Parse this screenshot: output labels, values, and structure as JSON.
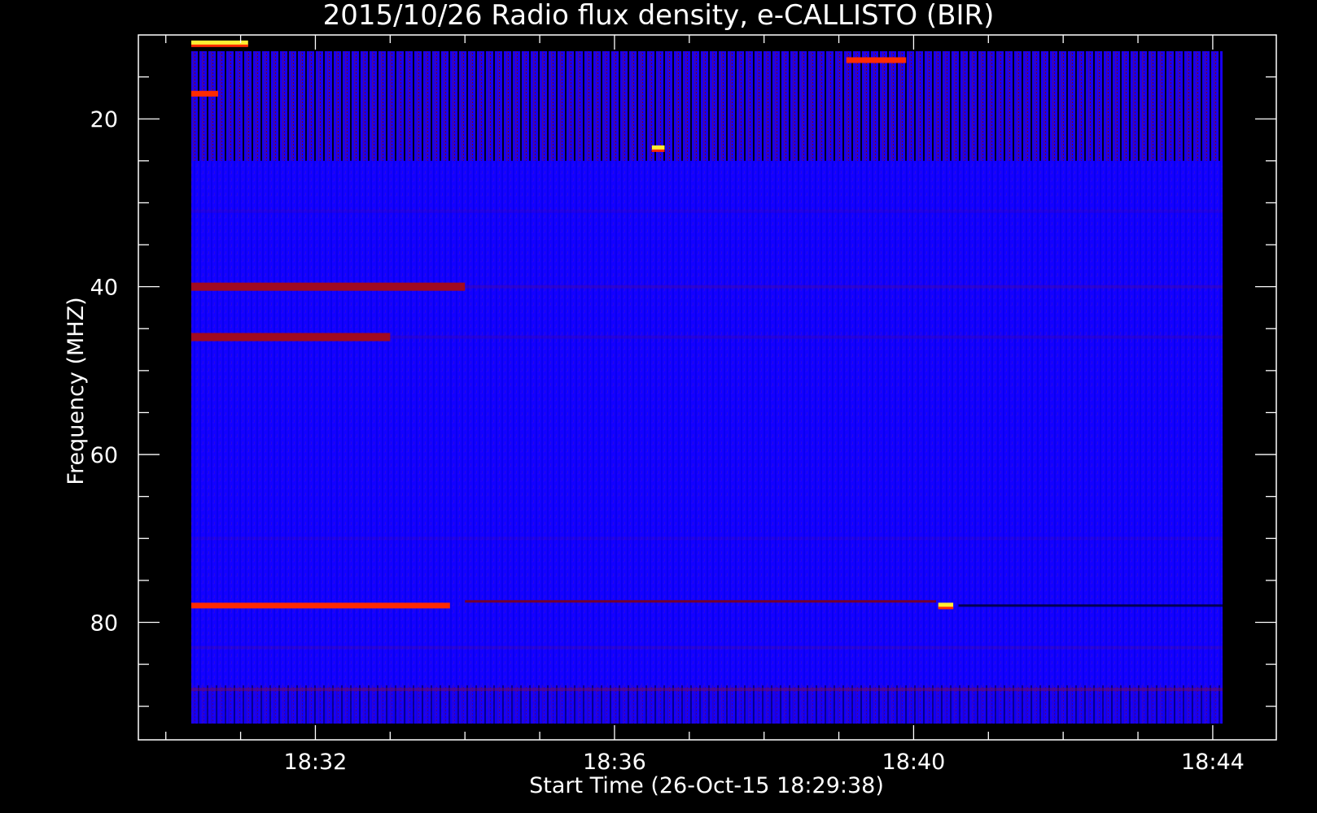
{
  "chart_data": {
    "type": "heatmap",
    "title": "2015/10/26  Radio flux density, e-CALLISTO (BIR)",
    "xlabel": "Start Time (26-Oct-15 18:29:38)",
    "ylabel": "Frequency (MHZ)",
    "x_ticks": [
      "18:32",
      "18:36",
      "18:40",
      "18:44"
    ],
    "x_tick_minutes": [
      32,
      36,
      40,
      44
    ],
    "xlim_minutes": [
      29.633,
      44.85
    ],
    "y_ticks": [
      20,
      40,
      60,
      80
    ],
    "ylim": [
      10,
      94
    ],
    "y_inverted": true,
    "colormap": [
      "#000000",
      "#1a00ff",
      "#0000ff",
      "#8b0000",
      "#ff2a00",
      "#ffff33"
    ],
    "background_level": "blue",
    "features": [
      {
        "name": "",
        "freq_mhz": 78,
        "start_minute": 30.0,
        "end_minute": 33.8,
        "intensity": "high"
      },
      {
        "name": "",
        "freq_mhz": 40,
        "start_minute": 30.0,
        "end_minute": 34.0,
        "intensity": "medium"
      },
      {
        "name": "",
        "freq_mhz": 46,
        "start_minute": 30.0,
        "end_minute": 33.0,
        "intensity": "medium"
      },
      {
        "name": "",
        "freq_mhz": 11,
        "start_minute": 30.0,
        "end_minute": 31.1,
        "intensity": "very-high"
      },
      {
        "name": "",
        "freq_mhz": 17,
        "start_minute": 30.0,
        "end_minute": 30.7,
        "intensity": "high"
      },
      {
        "name": "",
        "freq_mhz": 78,
        "start_minute": 40.33,
        "end_minute": 40.53,
        "intensity": "very-high"
      },
      {
        "name": "",
        "freq_mhz": 23.5,
        "start_minute": 36.5,
        "end_minute": 36.67,
        "intensity": "very-high"
      },
      {
        "name": "",
        "freq_mhz": 13,
        "start_minute": 39.1,
        "end_minute": 39.9,
        "intensity": "high"
      }
    ]
  }
}
